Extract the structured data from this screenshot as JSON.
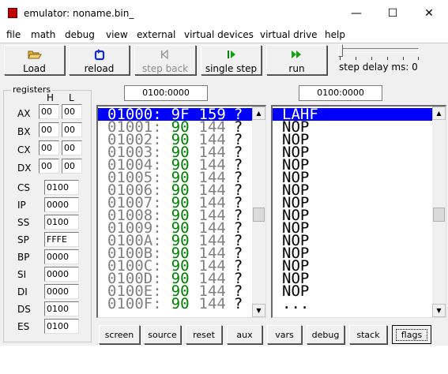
{
  "window": {
    "title": "emulator: noname.bin_",
    "minimize": "—",
    "maximize": "☐",
    "close": "✕"
  },
  "menu": [
    "file",
    "math",
    "debug",
    "view",
    "external",
    "virtual devices",
    "virtual drive",
    "help"
  ],
  "toolbar": {
    "load": "Load",
    "reload": "reload",
    "step_back": "step back",
    "single_step": "single step",
    "run": "run",
    "step_delay": "step delay ms: 0"
  },
  "registers": {
    "group_label": "registers",
    "h_label": "H",
    "l_label": "L",
    "general": [
      {
        "name": "AX",
        "h": "00",
        "l": "00"
      },
      {
        "name": "BX",
        "h": "00",
        "l": "00"
      },
      {
        "name": "CX",
        "h": "00",
        "l": "00"
      },
      {
        "name": "DX",
        "h": "00",
        "l": "00"
      }
    ],
    "segment": [
      {
        "name": "CS",
        "value": "0100"
      },
      {
        "name": "IP",
        "value": "0000"
      },
      {
        "name": "SS",
        "value": "0100"
      },
      {
        "name": "SP",
        "value": "FFFE"
      },
      {
        "name": "BP",
        "value": "0000"
      },
      {
        "name": "SI",
        "value": "0000"
      },
      {
        "name": "DI",
        "value": "0000"
      },
      {
        "name": "DS",
        "value": "0100"
      },
      {
        "name": "ES",
        "value": "0100"
      }
    ]
  },
  "memory": {
    "address_field": "0100:0000",
    "rows": [
      {
        "addr": "01000:",
        "hex": "9F",
        "dec": "159",
        "ch": "?",
        "selected": true
      },
      {
        "addr": "01001:",
        "hex": "90",
        "dec": "144",
        "ch": "?"
      },
      {
        "addr": "01002:",
        "hex": "90",
        "dec": "144",
        "ch": "?"
      },
      {
        "addr": "01003:",
        "hex": "90",
        "dec": "144",
        "ch": "?"
      },
      {
        "addr": "01004:",
        "hex": "90",
        "dec": "144",
        "ch": "?"
      },
      {
        "addr": "01005:",
        "hex": "90",
        "dec": "144",
        "ch": "?"
      },
      {
        "addr": "01006:",
        "hex": "90",
        "dec": "144",
        "ch": "?"
      },
      {
        "addr": "01007:",
        "hex": "90",
        "dec": "144",
        "ch": "?"
      },
      {
        "addr": "01008:",
        "hex": "90",
        "dec": "144",
        "ch": "?"
      },
      {
        "addr": "01009:",
        "hex": "90",
        "dec": "144",
        "ch": "?"
      },
      {
        "addr": "0100A:",
        "hex": "90",
        "dec": "144",
        "ch": "?"
      },
      {
        "addr": "0100B:",
        "hex": "90",
        "dec": "144",
        "ch": "?"
      },
      {
        "addr": "0100C:",
        "hex": "90",
        "dec": "144",
        "ch": "?"
      },
      {
        "addr": "0100D:",
        "hex": "90",
        "dec": "144",
        "ch": "?"
      },
      {
        "addr": "0100E:",
        "hex": "90",
        "dec": "144",
        "ch": "?"
      },
      {
        "addr": "0100F:",
        "hex": "90",
        "dec": "144",
        "ch": "?"
      }
    ]
  },
  "disassembly": {
    "address_field": "0100:0000",
    "rows": [
      "LAHF",
      "NOP",
      "NOP",
      "NOP",
      "NOP",
      "NOP",
      "NOP",
      "NOP",
      "NOP",
      "NOP",
      "NOP",
      "NOP",
      "NOP",
      "NOP",
      "NOP",
      "..."
    ]
  },
  "bottom_buttons": [
    "screen",
    "source",
    "reset",
    "aux",
    "vars",
    "debug",
    "stack",
    "flags"
  ],
  "colors": {
    "selection": "#0000ff",
    "hex_value": "#008000",
    "address_dim": "#808080"
  }
}
